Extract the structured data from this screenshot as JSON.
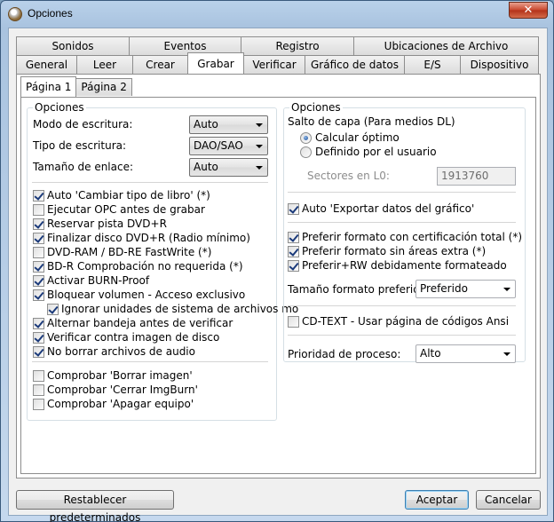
{
  "window": {
    "title": "Opciones",
    "close_label": "✕"
  },
  "tabs_row1": [
    "Sonidos",
    "Eventos",
    "Registro",
    "Ubicaciones de Archivo"
  ],
  "tabs_row2": [
    "General",
    "Leer",
    "Crear",
    "Grabar",
    "Verificar",
    "Gráfico de datos",
    "E/S",
    "Dispositivo"
  ],
  "active_tab": "Grabar",
  "subtabs": [
    "Página 1",
    "Página 2"
  ],
  "left": {
    "group_title": "Opciones",
    "modo_label": "Modo de escritura:",
    "modo_value": "Auto",
    "tipo_label": "Tipo de escritura:",
    "tipo_value": "DAO/SAO",
    "tam_label": "Tamaño de enlace:",
    "tam_value": "Auto",
    "checks": [
      {
        "label": "Auto 'Cambiar tipo de libro' (*)",
        "checked": true
      },
      {
        "label": "Ejecutar OPC antes de grabar",
        "checked": false
      },
      {
        "label": "Reservar pista DVD+R",
        "checked": true
      },
      {
        "label": "Finalizar disco DVD+R (Radio mínimo)",
        "checked": true
      },
      {
        "label": "DVD-RAM / BD-RE FastWrite (*)",
        "checked": false
      },
      {
        "label": "BD-R Comprobación no requerida (*)",
        "checked": true
      },
      {
        "label": "Activar BURN-Proof",
        "checked": true
      },
      {
        "label": "Bloquear volumen - Acceso exclusivo",
        "checked": true
      },
      {
        "label": "Ignorar unidades de sistema de archivos mo",
        "checked": true,
        "indent": true
      },
      {
        "label": "Alternar bandeja antes de verificar",
        "checked": true
      },
      {
        "label": "Verificar contra imagen de disco",
        "checked": true
      },
      {
        "label": "No borrar archivos de audio",
        "checked": true
      }
    ],
    "checks2": [
      {
        "label": "Comprobar 'Borrar imagen'",
        "checked": false
      },
      {
        "label": "Comprobar 'Cerrar ImgBurn'",
        "checked": false
      },
      {
        "label": "Comprobar 'Apagar equipo'",
        "checked": false
      }
    ]
  },
  "right": {
    "group_title": "Opciones",
    "salto_label": "Salto de capa (Para medios DL)",
    "radio1": "Calcular óptimo",
    "radio2": "Definido por el usuario",
    "sectores_label": "Sectores en L0:",
    "sectores_value": "1913760",
    "auto_export": "Auto 'Exportar datos del gráfico'",
    "pref1": "Preferir formato con certificación total (*)",
    "pref2": "Preferir formato sin áreas extra (*)",
    "pref3": "Preferir+RW debidamente formateado",
    "tam_formato_label": "Tamaño formato preferido:",
    "tam_formato_value": "Preferido",
    "cdtext": "CD-TEXT - Usar página de códigos Ansi",
    "prioridad_label": "Prioridad de proceso:",
    "prioridad_value": "Alto"
  },
  "buttons": {
    "reset": "Restablecer predeterminados",
    "ok": "Aceptar",
    "cancel": "Cancelar"
  }
}
